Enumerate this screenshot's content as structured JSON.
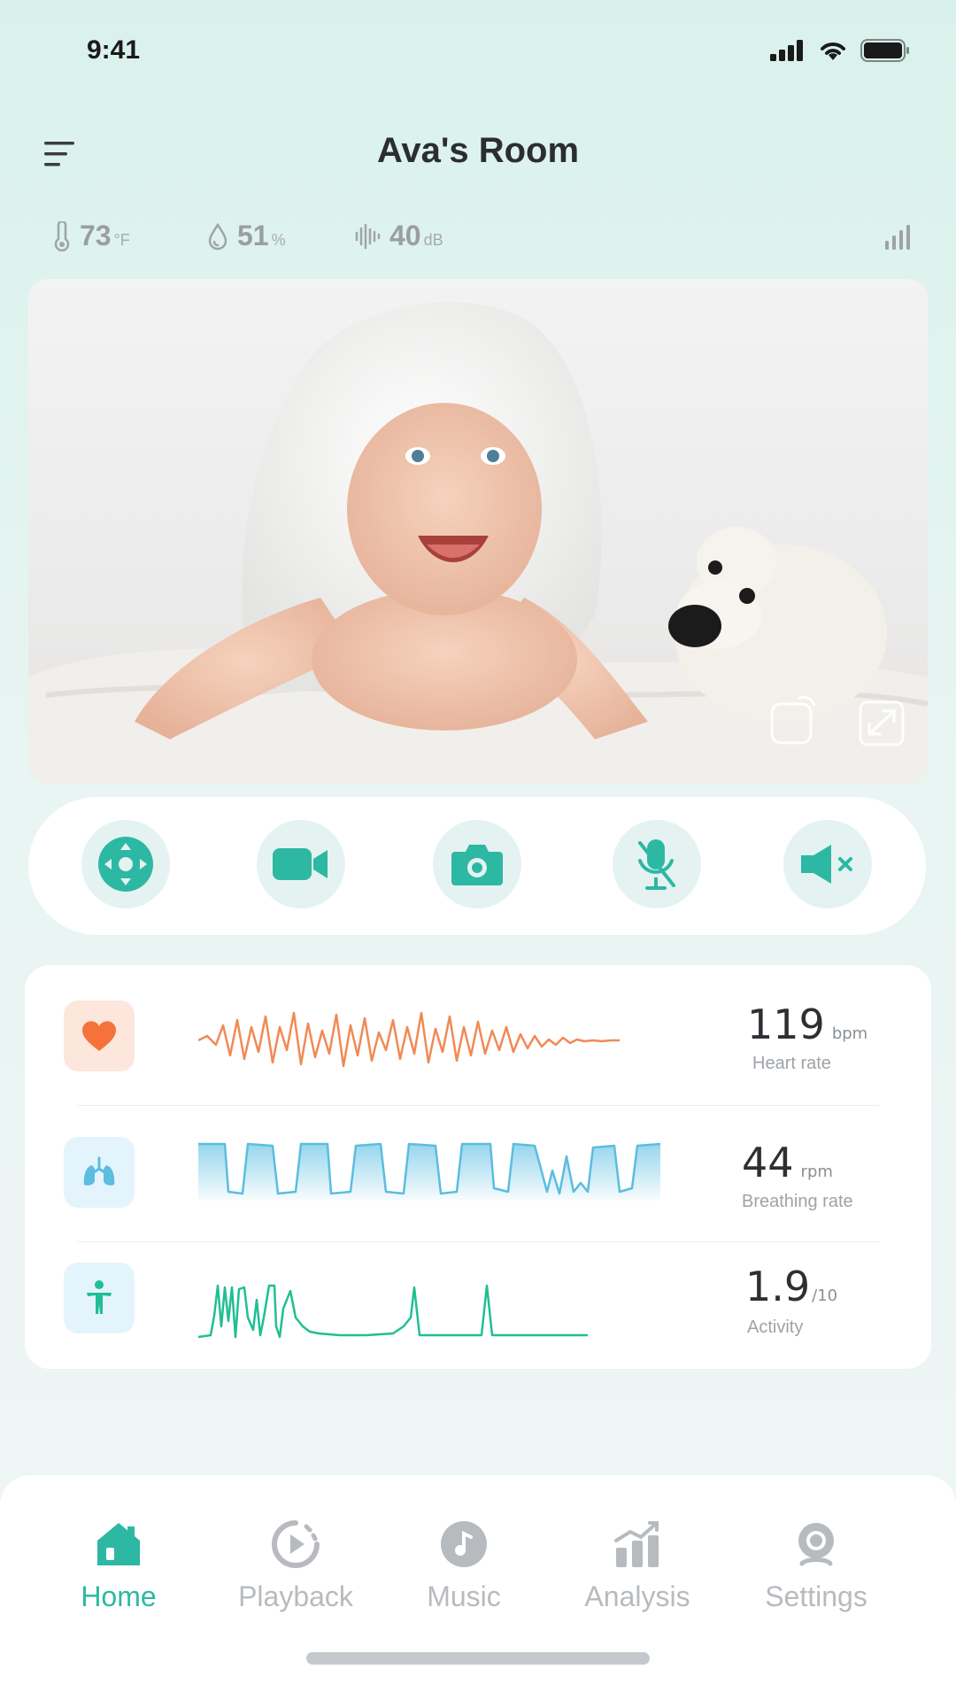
{
  "status": {
    "time": "9:41"
  },
  "header": {
    "title": "Ava's Room"
  },
  "environment": {
    "temperature": {
      "value": "73",
      "unit": "°F"
    },
    "humidity": {
      "value": "51",
      "unit": "%"
    },
    "noise": {
      "value": "40",
      "unit": "dB"
    }
  },
  "vitals": {
    "heart": {
      "value": "119",
      "unit": "bpm",
      "label": "Heart rate"
    },
    "breathing": {
      "value": "44",
      "unit": "rpm",
      "label": "Breathing rate"
    },
    "activity": {
      "value": "1.9",
      "unit": "/10",
      "label": "Activity"
    }
  },
  "nav": {
    "items": [
      {
        "label": "Home",
        "icon": "home-icon",
        "active": true
      },
      {
        "label": "Playback",
        "icon": "playback-icon",
        "active": false
      },
      {
        "label": "Music",
        "icon": "music-icon",
        "active": false
      },
      {
        "label": "Analysis",
        "icon": "analysis-icon",
        "active": false
      },
      {
        "label": "Settings",
        "icon": "settings-icon",
        "active": false
      }
    ]
  },
  "colors": {
    "accent": "#2db8a3",
    "heart": "#f08a55",
    "breathing": "#5bbde0",
    "activity": "#1fbf93"
  }
}
